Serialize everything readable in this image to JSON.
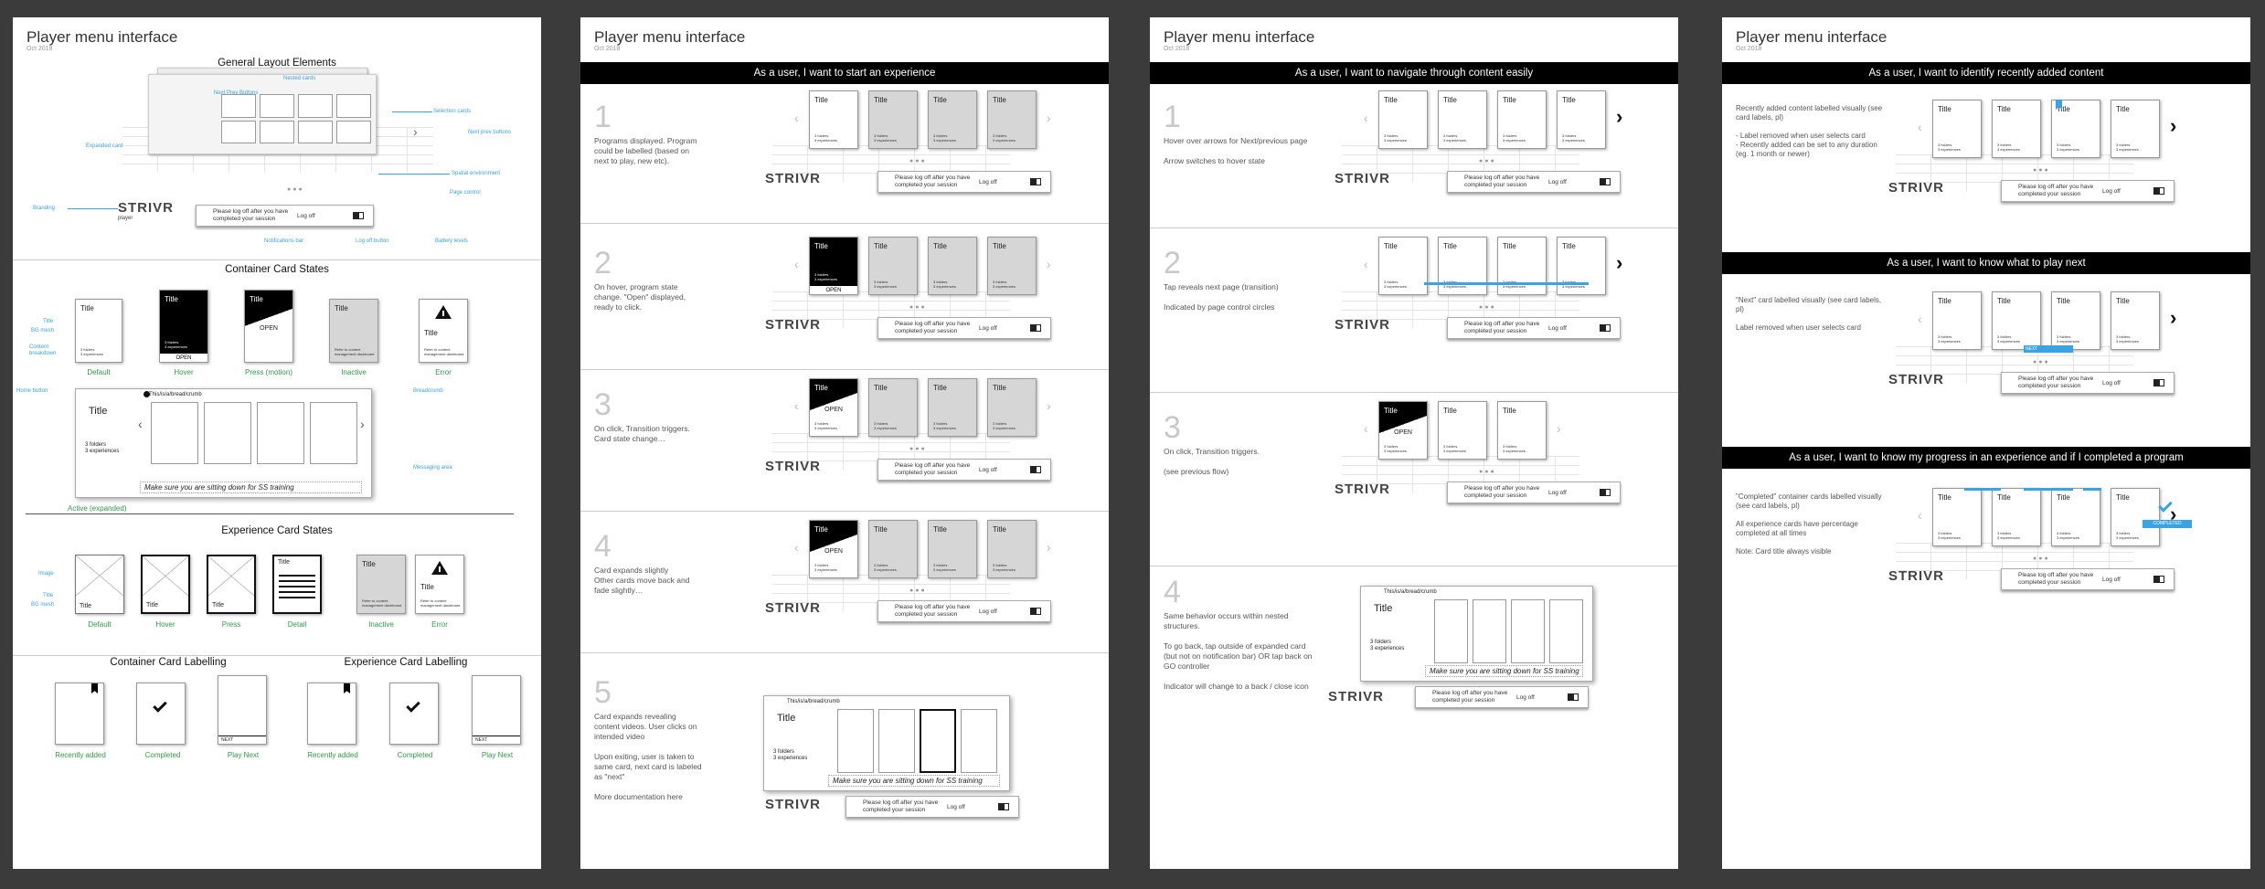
{
  "panels": [
    {
      "title": "Player menu interface",
      "date": "Oct 2018"
    },
    {
      "title": "Player menu interface",
      "date": "Oct 2018"
    },
    {
      "title": "Player menu interface",
      "date": "Oct 2018"
    },
    {
      "title": "Player menu interface",
      "date": "Oct 2018"
    }
  ],
  "p1": {
    "general": "General Layout Elements",
    "ann": {
      "next_prev": "Next Prev Buttons",
      "nested": "Nested cards",
      "selection": "Selection cards",
      "expanded": "Expanded card",
      "nextprev2": "Next prev buttons",
      "spatial": "Spatial environment",
      "pagecontrol": "Page control",
      "branding": "Branding",
      "notif": "Notifications bar",
      "logoff": "Log off button",
      "battery": "Battery levels",
      "title": "Title",
      "bg": "BG mesh",
      "content": "Content breakdown",
      "home": "Home button",
      "breadcrumb": "Breadcrumb",
      "messaging": "Messaging area",
      "image": "Image",
      "title2": "Title",
      "bg2": "BG mesh"
    },
    "container_states": "Container Card States",
    "cstates": [
      "Default",
      "Hover",
      "Press (motion)",
      "Inactive",
      "Error"
    ],
    "active": "Active (expanded)",
    "experience_states": "Experience Card States",
    "estates": [
      "Default",
      "Hover",
      "Press",
      "Detail",
      "Inactive",
      "Error"
    ],
    "container_labelling": "Container Card Labelling",
    "experience_labelling": "Experience Card Labelling",
    "labels": [
      "Recently added",
      "Completed",
      "Play Next",
      "Recently added",
      "Completed",
      "Play Next"
    ]
  },
  "common": {
    "card_title": "Title",
    "card_meta": "3 folders\n3 experiences",
    "open": "OPEN",
    "next": "NEXT",
    "completed_tag": "COMPLETED",
    "notif_msg": "Please log off after you have\ncompleted your session",
    "logoff": "Log off",
    "brand": "STRIVR",
    "brand_sub": "player",
    "breadcrumb": "This/is/a/bread/crumb",
    "folders": "3 folders\n3 experiences",
    "message": "Make sure you are sitting down for SS training",
    "err_msg": "Refer to content management dashboard",
    "dots": "●●●"
  },
  "p2": {
    "band": "As a user, I want to start an experience",
    "steps": [
      {
        "n": "1",
        "text": "Programs displayed. Program could be labelled (based on next to play, new etc)."
      },
      {
        "n": "2",
        "text": "On hover, program state change. \"Open\" displayed, ready to click."
      },
      {
        "n": "3",
        "text": "On click, Transition triggers. Card state change…"
      },
      {
        "n": "4",
        "text": "Card expands slightly\nOther cards move back and fade slightly…"
      },
      {
        "n": "5",
        "text": "Card expands revealing content videos. User clicks on intended video\n\nUpon exiting, user is taken to same card, next card is labeled as \"next\"\n\nMore documentation here"
      }
    ]
  },
  "p3": {
    "band": "As a user, I want to navigate through content easily",
    "steps": [
      {
        "n": "1",
        "text": "Hover over arrows for Next/previous page\n\nArrow switches to hover state"
      },
      {
        "n": "2",
        "text": "Tap reveals next page (transition)\n\nIndicated by page control circles"
      },
      {
        "n": "3",
        "text": "On click, Transition triggers.\n\n(see previous flow)"
      },
      {
        "n": "4",
        "text": "Same behavior occurs within nested structures.\n\nTo go back, tap outside of expanded card (but not on notification bar) OR tap back on GO controller\n\nIndicator will change to a back / close icon"
      }
    ]
  },
  "p4": {
    "bands": [
      "As a user, I want to identify recently added content",
      "As a user, I want to know what to play next",
      "As a user, I want to know my progress in an experience and if I completed a program"
    ],
    "texts": [
      "Recently added content labelled visually (see card labels, pl)\n\n- Label removed when user selects card\n- Recently added can be set to any duration (eg. 1 month or newer)",
      "\"Next\" card labelled visually (see card labels, pl)\n\nLabel removed when user selects card",
      "\"Completed\" container cards labelled visually (see card labels, pl)\n\nAll experience cards have percentage completed at all times\n\nNote: Card title always visible"
    ]
  }
}
